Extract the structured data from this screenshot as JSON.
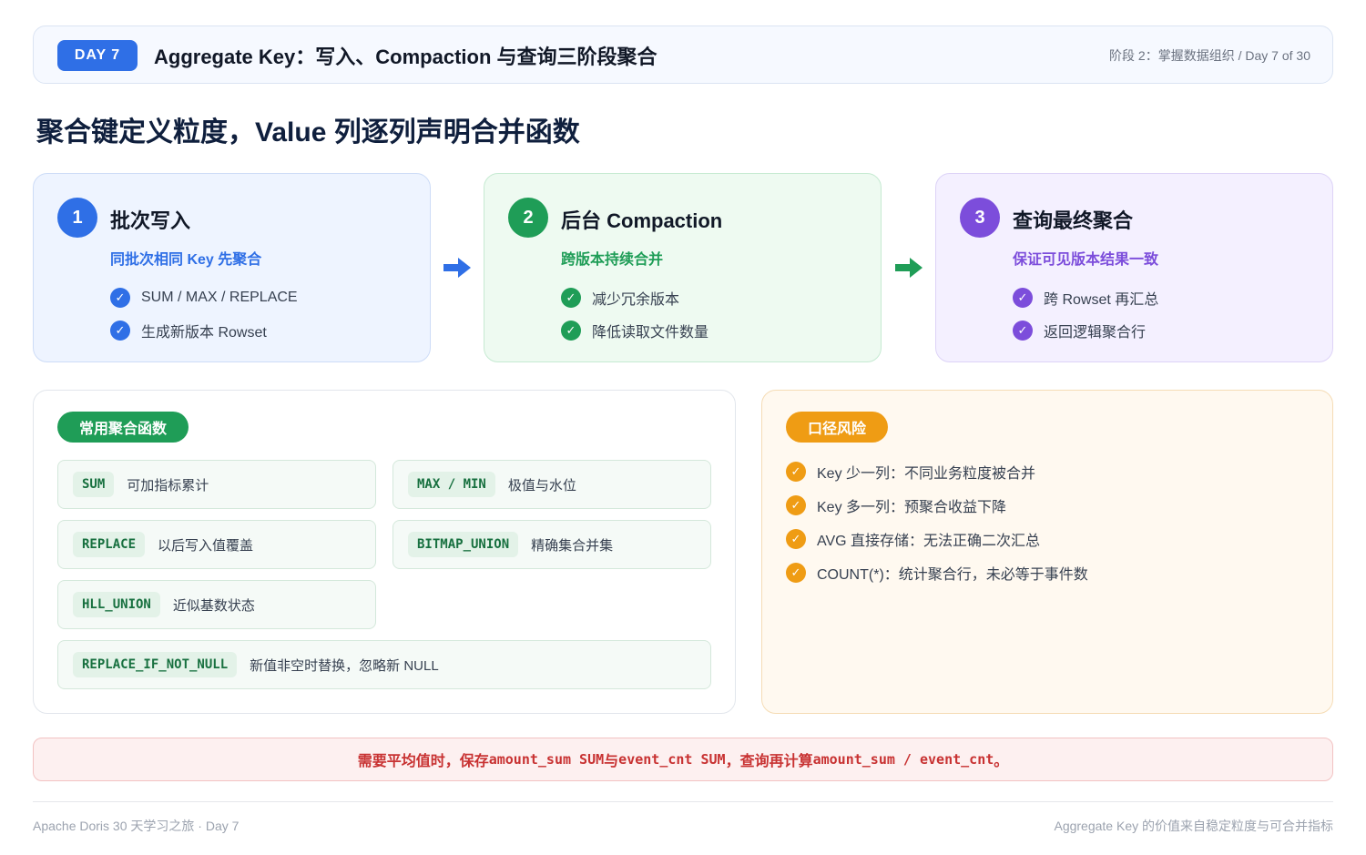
{
  "header": {
    "badge": "DAY 7",
    "title": "Aggregate Key：写入、Compaction 与查询三阶段聚合",
    "meta": "阶段 2：掌握数据组织 / Day 7 of 30"
  },
  "page_title": "聚合键定义粒度，Value 列逐列声明合并函数",
  "stages": [
    {
      "num": "1",
      "title": "批次写入",
      "subtitle": "同批次相同 Key 先聚合",
      "items": [
        "SUM / MAX / REPLACE",
        "生成新版本 Rowset"
      ],
      "color": "#2f6fe6"
    },
    {
      "num": "2",
      "title": "后台 Compaction",
      "subtitle": "跨版本持续合并",
      "items": [
        "减少冗余版本",
        "降低读取文件数量"
      ],
      "color": "#1f9d57"
    },
    {
      "num": "3",
      "title": "查询最终聚合",
      "subtitle": "保证可见版本结果一致",
      "items": [
        "跨 Rowset 再汇总",
        "返回逻辑聚合行"
      ],
      "color": "#7c4ddb"
    }
  ],
  "functions": {
    "label": "常用聚合函数",
    "items": [
      {
        "code": "SUM",
        "desc": "可加指标累计"
      },
      {
        "code": "MAX / MIN",
        "desc": "极值与水位"
      },
      {
        "code": "REPLACE",
        "desc": "以后写入值覆盖"
      },
      {
        "code": "BITMAP_UNION",
        "desc": "精确集合并集"
      },
      {
        "code": "HLL_UNION",
        "desc": "近似基数状态"
      },
      {
        "code": "REPLACE_IF_NOT_NULL",
        "desc": "新值非空时替换，忽略新 NULL"
      }
    ]
  },
  "risks": {
    "label": "口径风险",
    "items": [
      "Key 少一列：不同业务粒度被合并",
      "Key 多一列：预聚合收益下降",
      "AVG 直接存储：无法正确二次汇总",
      "COUNT(*)：统计聚合行，未必等于事件数"
    ]
  },
  "note": {
    "p1": "需要平均值时，保存 ",
    "c1": "amount_sum SUM",
    "p2": " 与 ",
    "c2": "event_cnt SUM",
    "p3": "，查询再计算 ",
    "c3": "amount_sum / event_cnt",
    "p4": "。"
  },
  "footer": {
    "left": "Apache Doris 30 天学习之旅 · Day 7",
    "right": "Aggregate Key 的价值来自稳定粒度与可合并指标"
  },
  "icons": {
    "check": "check-circle-icon",
    "arrow": "arrow-right-icon"
  },
  "colors": {
    "blue": "#2f6fe6",
    "green": "#1f9d57",
    "purple": "#7c4ddb",
    "orange": "#ef9c14",
    "red": "#c83232"
  }
}
